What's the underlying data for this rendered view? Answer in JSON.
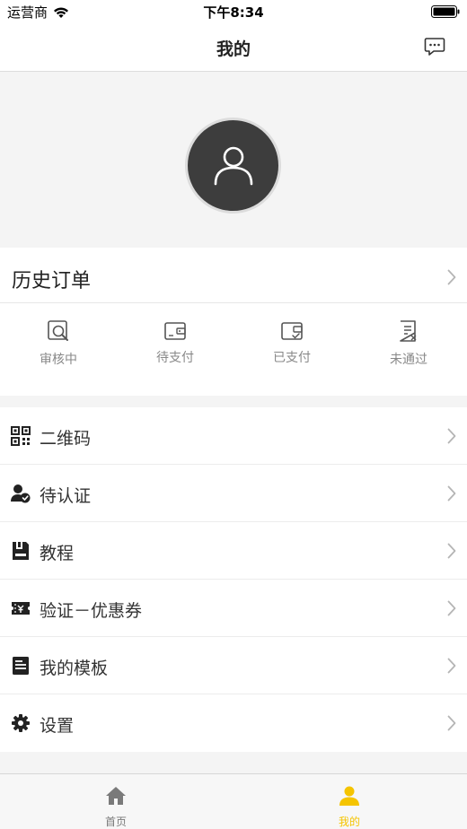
{
  "status_bar": {
    "carrier": "运营商",
    "time": "下午8:34"
  },
  "nav": {
    "title": "我的",
    "message_icon": "message-bubble-icon"
  },
  "profile": {
    "avatar_icon": "user-avatar-icon"
  },
  "orders": {
    "title": "历史订单",
    "statuses": [
      {
        "label": "审核中",
        "icon": "review-icon"
      },
      {
        "label": "待支付",
        "icon": "wallet-pending-icon"
      },
      {
        "label": "已支付",
        "icon": "wallet-paid-icon"
      },
      {
        "label": "未通过",
        "icon": "rejected-doc-icon"
      }
    ]
  },
  "menu": {
    "items": [
      {
        "label": "二维码",
        "icon": "qrcode-icon"
      },
      {
        "label": "待认证",
        "icon": "user-verify-icon"
      },
      {
        "label": "教程",
        "icon": "tutorial-icon"
      },
      {
        "label": "验证－优惠券",
        "icon": "coupon-icon"
      },
      {
        "label": "我的模板",
        "icon": "template-icon"
      },
      {
        "label": "设置",
        "icon": "settings-gear-icon"
      }
    ]
  },
  "tabbar": {
    "tabs": [
      {
        "label": "首页",
        "icon": "home-icon"
      },
      {
        "label": "我的",
        "icon": "profile-icon",
        "active": true
      }
    ],
    "colors": {
      "active": "#f5c400",
      "inactive": "#7a7a7a"
    }
  }
}
